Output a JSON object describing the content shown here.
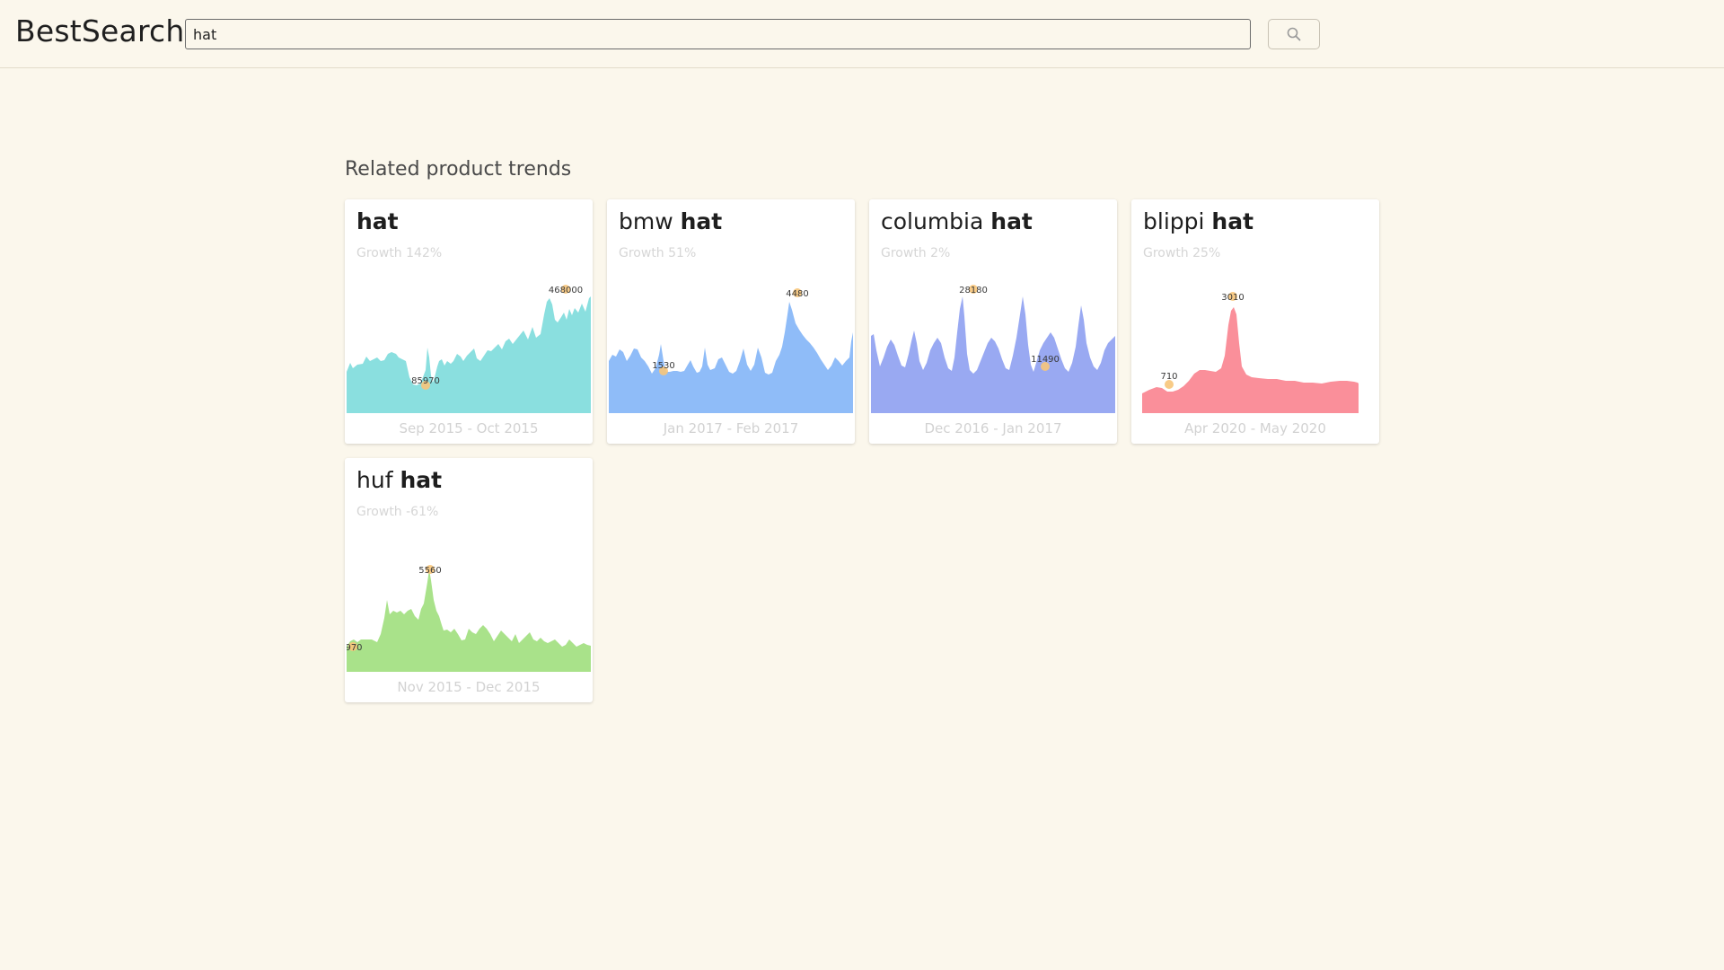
{
  "app": {
    "logo": "BestSearch"
  },
  "search": {
    "value": "hat",
    "button_icon": "search-icon"
  },
  "section": {
    "title": "Related product trends"
  },
  "cards": [
    {
      "prefix": "",
      "keyword": "hat",
      "growth": "Growth 142%",
      "range": "Sep 2015 - Oct 2015",
      "color": "#8adfdf",
      "high_label": "468000",
      "low_label": "85970"
    },
    {
      "prefix": "bmw ",
      "keyword": "hat",
      "growth": "Growth 51%",
      "range": "Jan 2017 - Feb 2017",
      "color": "#8fbcf8",
      "high_label": "4480",
      "low_label": "1530"
    },
    {
      "prefix": "columbia ",
      "keyword": "hat",
      "growth": "Growth 2%",
      "range": "Dec 2016 - Jan 2017",
      "color": "#99a9f2",
      "high_label": "28180",
      "low_label": "11490"
    },
    {
      "prefix": "blippi ",
      "keyword": "hat",
      "growth": "Growth 25%",
      "range": "Apr 2020 - May 2020",
      "color": "#fa8f9a",
      "high_label": "3010",
      "low_label": "710"
    },
    {
      "prefix": "huf ",
      "keyword": "hat",
      "growth": "Growth -61%",
      "range": "Nov 2015 - Dec 2015",
      "color": "#a9e28a",
      "high_label": "5560",
      "low_label": "970"
    }
  ]
}
